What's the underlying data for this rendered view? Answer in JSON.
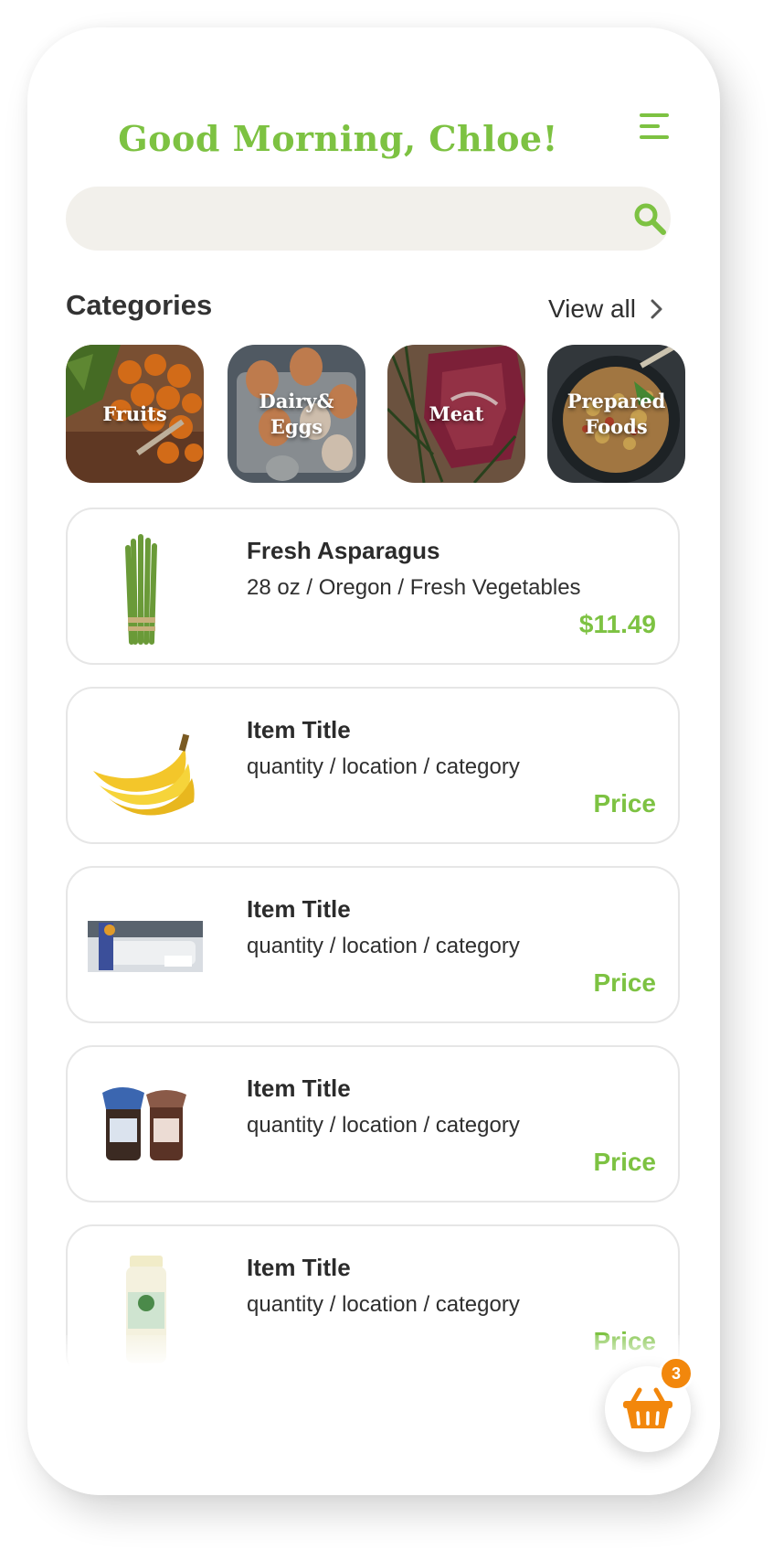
{
  "header": {
    "greeting": "Good Morning, Chloe!",
    "menu_icon": "menu-icon"
  },
  "search": {
    "placeholder": "",
    "value": "",
    "icon": "search-icon"
  },
  "categories": {
    "title": "Categories",
    "view_all": "View all",
    "items": [
      {
        "line1": "Fruits",
        "line2": ""
      },
      {
        "line1": "Dairy&",
        "line2": "Eggs"
      },
      {
        "line1": "Meat",
        "line2": ""
      },
      {
        "line1": "Prepared",
        "line2": "Foods"
      }
    ]
  },
  "products": [
    {
      "title": "Fresh Asparagus",
      "meta": "28 oz / Oregon / Fresh Vegetables",
      "price": "$11.49"
    },
    {
      "title": "Item Title",
      "meta": "quantity / location / category",
      "price": "Price"
    },
    {
      "title": "Item Title",
      "meta": "quantity / location / category",
      "price": "Price"
    },
    {
      "title": "Item Title",
      "meta": "quantity / location / category",
      "price": "Price"
    },
    {
      "title": "Item Title",
      "meta": "quantity / location / category",
      "price": "Price"
    }
  ],
  "cart": {
    "icon": "basket-icon",
    "count": "3"
  },
  "colors": {
    "accent": "#7dc242",
    "badge": "#f2870c",
    "search_bg": "#f2f0eb"
  }
}
